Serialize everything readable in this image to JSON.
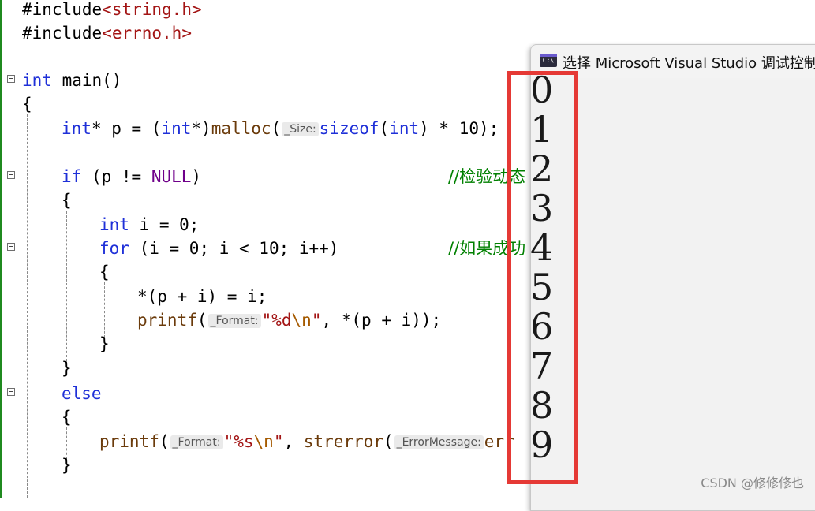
{
  "code": {
    "l1": {
      "hash": "#include",
      "open": "<",
      "file": "string.h",
      "close": ">"
    },
    "l2": {
      "hash": "#include",
      "open": "<",
      "file": "errno.h",
      "close": ">"
    },
    "l3": {
      "type": "int",
      "name": " main()"
    },
    "l4": "{",
    "l5": {
      "type": "int",
      "rest1": "* p = (",
      "cast": "int",
      "rest2": "*)",
      "fn": "malloc",
      "paren": "(",
      "hint": "_Size:",
      "sizeof": "sizeof",
      "p2": "(",
      "type2": "int",
      "rest3": ") * 10);",
      "cmt": "/"
    },
    "l6": {
      "kw": "if",
      "rest": " (p != ",
      "mac": "NULL",
      "close": ")",
      "cmt": "//检验动态"
    },
    "l7": "{",
    "l8": {
      "type": "int",
      "rest": " i = 0;"
    },
    "l9": {
      "kw": "for",
      "rest": " (i = 0; i < 10; i++)",
      "cmt": "//如果成功"
    },
    "l10": "{",
    "l11": "*(p + i) = i;",
    "l12": {
      "fn": "printf",
      "open": "(",
      "hint": "_Format:",
      "str1": "\"%d",
      "esc": "\\n",
      "str2": "\"",
      "rest": ", *(p + i));"
    },
    "l13": "}",
    "l14": "}",
    "l15": {
      "kw": "else"
    },
    "l16": "{",
    "l17": {
      "fn": "printf",
      "open": "(",
      "hint": "_Format:",
      "str1": "\"%s",
      "esc": "\\n",
      "str2": "\"",
      "rest": ", ",
      "fn2": "strerror",
      "open2": "(",
      "hint2": "_ErrorMessage:",
      "tail": "err"
    },
    "l18": "}"
  },
  "console": {
    "title": "选择 Microsoft Visual Studio 调试控制台",
    "icon_label": "C:\\",
    "output": [
      "0",
      "1",
      "2",
      "3",
      "4",
      "5",
      "6",
      "7",
      "8",
      "9"
    ]
  },
  "watermark": "CSDN @修修修也",
  "colors": {
    "keyword": "#1f30d8",
    "function": "#6b3b0b",
    "string": "#a31515",
    "comment": "#008000",
    "macro": "#6f008a",
    "highlight": "#e53935"
  },
  "icons": {
    "fold": "collapse-box-icon",
    "console": "console-app-icon"
  }
}
